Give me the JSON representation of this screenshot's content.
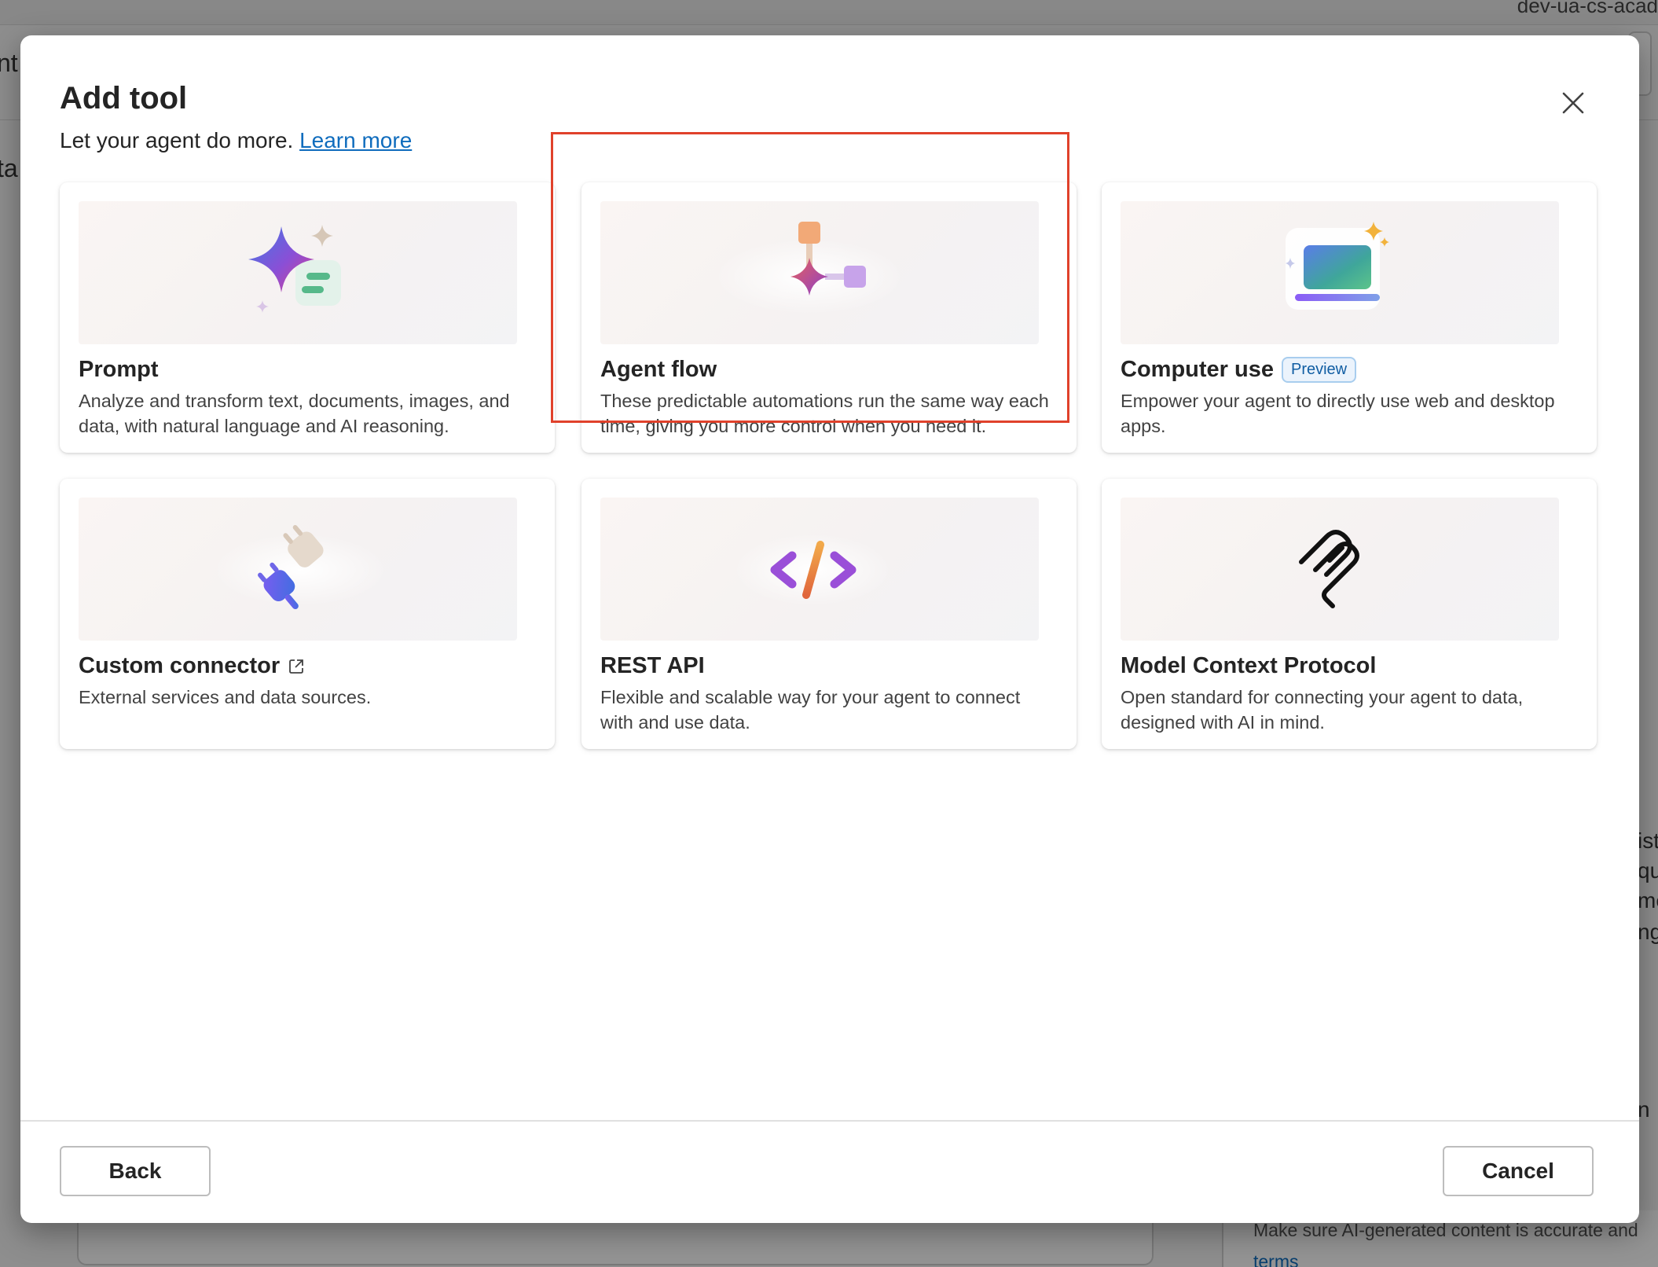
{
  "background": {
    "environment_fragment": "dev-ua-cs-acad",
    "left_fragments": [
      "nt",
      "ta"
    ],
    "right_fragments": [
      "ist",
      "qu",
      "me",
      "ng",
      "n"
    ],
    "disclaimer": "Make sure AI-generated content is accurate and",
    "terms_link": "terms"
  },
  "dialog": {
    "title": "Add tool",
    "subtitle": "Let your agent do more.",
    "learn_more": "Learn more",
    "close_icon": "close-icon"
  },
  "tools": [
    {
      "title": "Prompt",
      "description": "Analyze and transform text, documents, images, and data, with natural language and AI reasoning.",
      "icon": "prompt-sparkle-icon"
    },
    {
      "title": "Agent flow",
      "description": "These predictable automations run the same way each time, giving you more control when you need it.",
      "icon": "agent-flow-icon",
      "highlighted": true
    },
    {
      "title": "Computer use",
      "badge": "Preview",
      "description": "Empower your agent to directly use web and desktop apps.",
      "icon": "computer-use-icon"
    },
    {
      "title": "Custom connector",
      "description": "External services and data sources.",
      "icon": "plug-icon",
      "trailing_icon": "open-external-icon"
    },
    {
      "title": "REST API",
      "description": "Flexible and scalable way for your agent to connect with and use data.",
      "icon": "code-brackets-icon"
    },
    {
      "title": "Model Context Protocol",
      "description": "Open standard for connecting your agent to data, designed with AI in mind.",
      "icon": "mcp-icon"
    }
  ],
  "footer": {
    "back_label": "Back",
    "cancel_label": "Cancel"
  },
  "colors": {
    "link": "#0f6cbd",
    "highlight_border": "#e0412b",
    "badge_text": "#115ea3",
    "badge_bg": "#ebf3fc"
  }
}
